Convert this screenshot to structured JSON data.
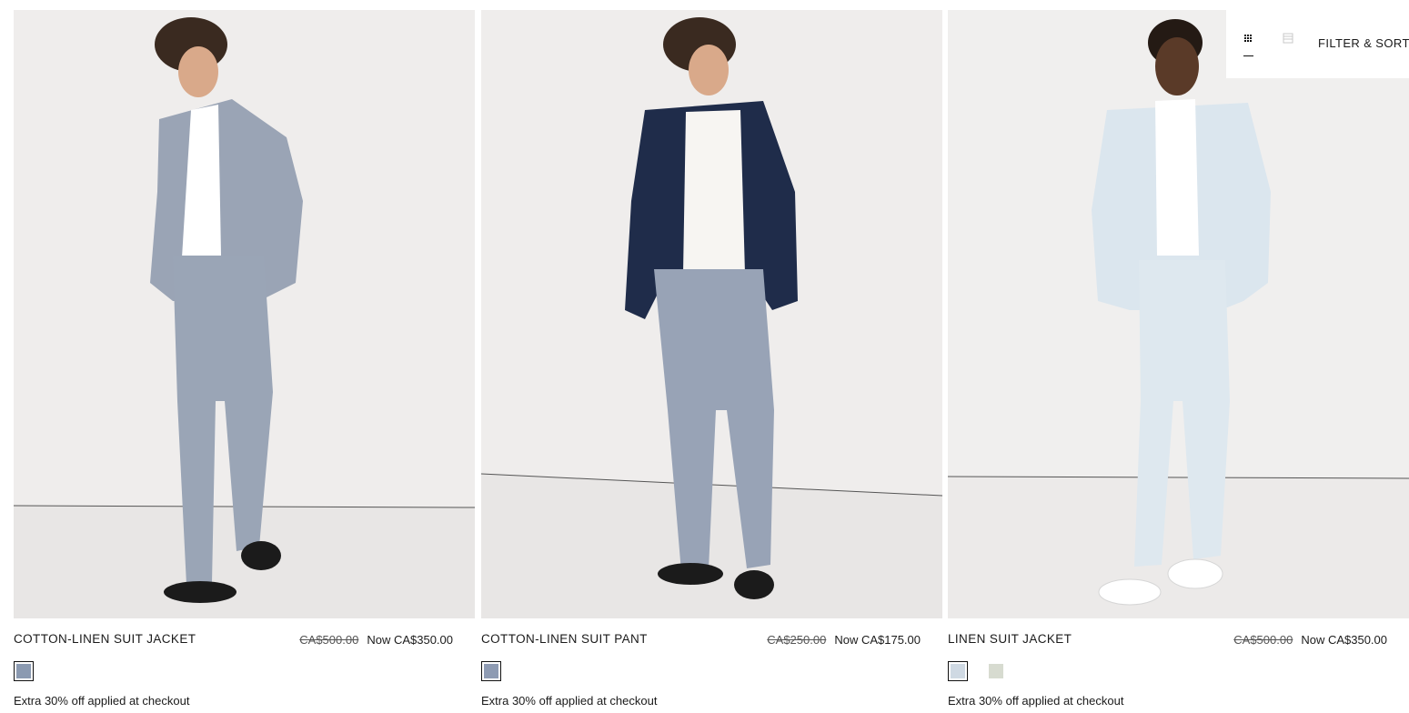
{
  "toolbar": {
    "grid_view_icon": "grid-3x3-icon",
    "list_view_icon": "grid-2-icon",
    "filter_sort_label": "FILTER & SORT"
  },
  "products": [
    {
      "name": "COTTON-LINEN SUIT JACKET",
      "old_price": "CA$500.00",
      "now_price": "Now CA$350.00",
      "swatches": [
        {
          "color": "#8b9ab1",
          "selected": true
        }
      ],
      "promo": "Extra 30% off applied at checkout",
      "image": "model-grey-cotton-linen-suit"
    },
    {
      "name": "COTTON-LINEN SUIT PANT",
      "old_price": "CA$250.00",
      "now_price": "Now CA$175.00",
      "swatches": [
        {
          "color": "#8e9bb3",
          "selected": true
        }
      ],
      "promo": "Extra 30% off applied at checkout",
      "image": "model-navy-suede-jacket-grey-pant"
    },
    {
      "name": "LINEN SUIT JACKET",
      "old_price": "CA$500.00",
      "now_price": "Now CA$350.00",
      "swatches": [
        {
          "color": "#cfd9e3",
          "selected": true
        },
        {
          "color": "#d7dbd0",
          "selected": false
        }
      ],
      "promo": "Extra 30% off applied at checkout",
      "image": "model-light-blue-linen-suit"
    }
  ],
  "colors": {
    "photo_bg": "#efedec",
    "floor": "#e9e7e6"
  }
}
